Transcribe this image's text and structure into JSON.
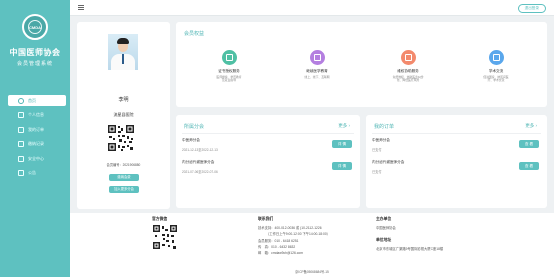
{
  "brand": {
    "logo_text": "CMDA",
    "name": "中国医师协会",
    "subtitle": "会员管理系统"
  },
  "nav": [
    {
      "label": "首页",
      "icon": "home-icon",
      "active": true
    },
    {
      "label": "个人信息",
      "icon": "user-icon",
      "active": false
    },
    {
      "label": "我的订单",
      "icon": "order-icon",
      "active": false
    },
    {
      "label": "缴纳记录",
      "icon": "payment-icon",
      "active": false
    },
    {
      "label": "安全中心",
      "icon": "shield-icon",
      "active": false
    },
    {
      "label": "公告",
      "icon": "notice-icon",
      "active": false
    }
  ],
  "topbar": {
    "logout_label": "退出登录"
  },
  "profile": {
    "name": "李明",
    "org": "流星县医院",
    "cert_label": "会员编号：",
    "cert_value": "2021906880",
    "btn_pay": "缴纳会费",
    "btn_join": "加入更多分会"
  },
  "benefits": {
    "title": "会员权益",
    "items": [
      {
        "title": "证书授权服务",
        "desc": [
          "医师继续、学历教育",
          "及就业指导"
        ],
        "icon": "certificate-icon",
        "color": "#4fc0a4"
      },
      {
        "title": "继续医学教育",
        "desc": [
          "线上、线下、互联网"
        ],
        "icon": "education-icon",
        "color": "#b47fe0"
      },
      {
        "title": "维权协助服务",
        "desc": [
          "免费维权、协助医患纠纷",
          "化、降低医疗风险"
        ],
        "icon": "protection-icon",
        "color": "#f38a6d"
      },
      {
        "title": "学术交流",
        "desc": [
          "促进国家、地区间医",
          "疗、学术交流"
        ],
        "icon": "exchange-icon",
        "color": "#5aa7ec"
      }
    ]
  },
  "branches": {
    "title": "所属分会",
    "more": "更多 ›",
    "rows": [
      {
        "name": "中医师分会",
        "date": "2021-12-13至2022-12-13",
        "action": "详 情"
      },
      {
        "name": "内分泌代谢医师分会",
        "date": "2021-07-06至2022-07-06",
        "action": "详 情"
      }
    ]
  },
  "orders": {
    "title": "我的订单",
    "more": "更多 ›",
    "rows": [
      {
        "name": "中医师分会",
        "status": "已支付",
        "action": "查 看"
      },
      {
        "name": "内分泌代谢医师分会",
        "status": "已支付",
        "action": "查 看"
      }
    ]
  },
  "footer": {
    "col1_title": "官方微信",
    "col2_title": "联系我们",
    "col2_lines": [
      "技术支持：400-012-0036 或 (10-2112-1226",
      "（工作日上午9:00-12:00 下午14:00-18:00）",
      "会员服务：010 - 6418 6251",
      "传　真：010 - 6432 8632",
      "邮　箱：cmdaw9ch@126.com"
    ],
    "col3_title": "主办单位",
    "col3_value": "中国医师协会",
    "col4_title": "单位地址",
    "col4_value": "北京市东城区广渠路9号国际影视大厦C座18楼",
    "copyright": "京ICP备05068684号-15"
  }
}
